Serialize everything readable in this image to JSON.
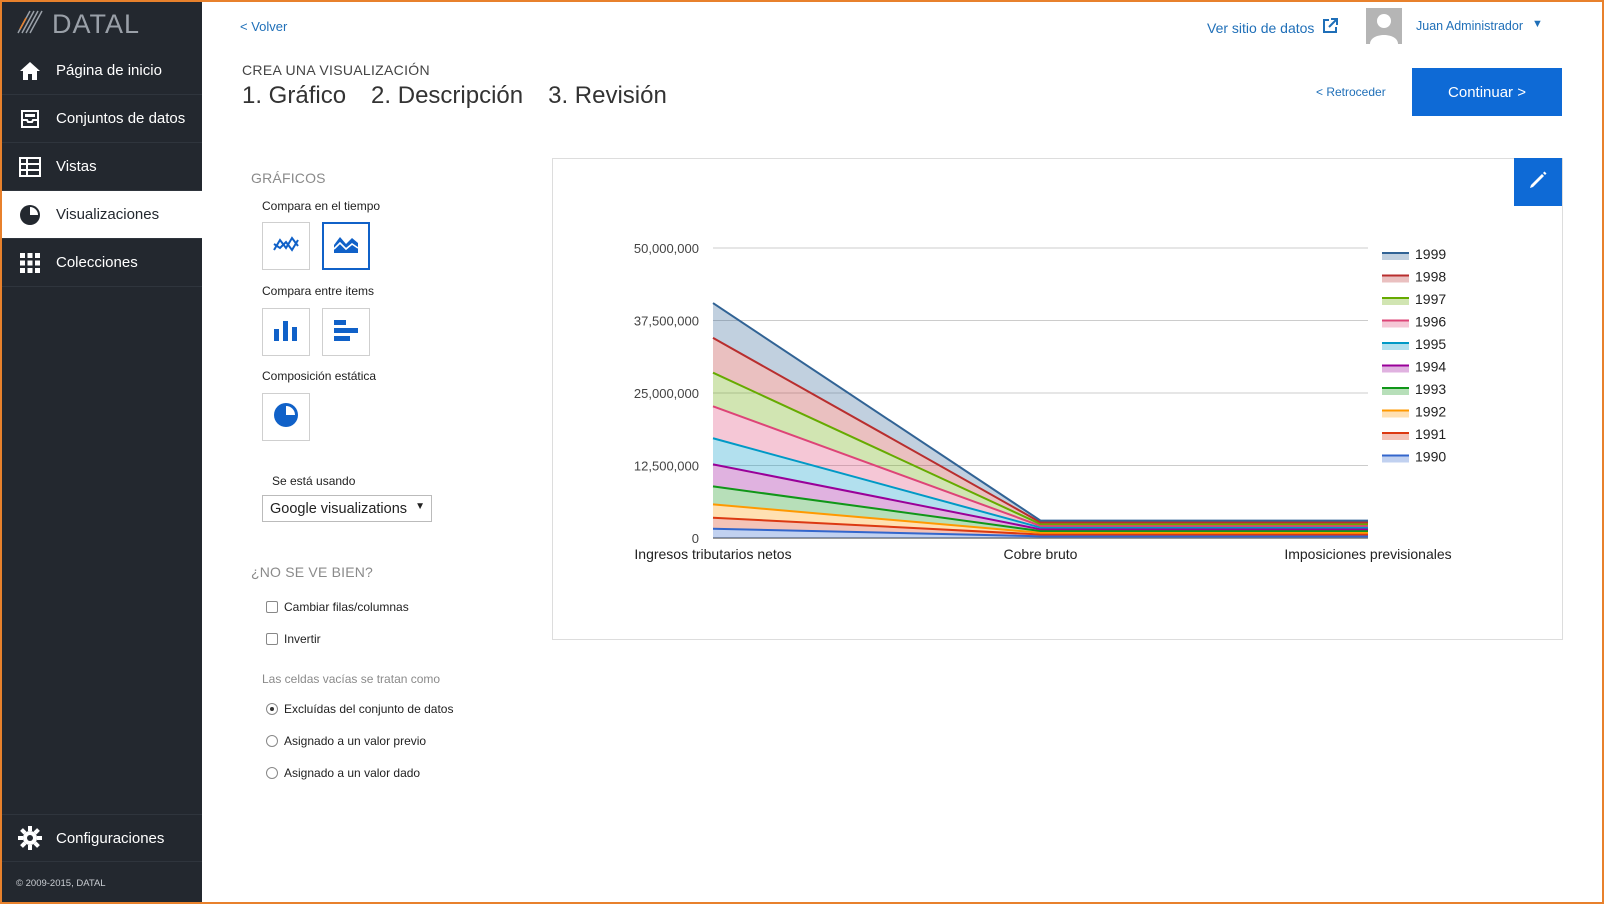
{
  "sidebar": {
    "logo": "DATAL",
    "items": [
      {
        "label": "Página de inicio",
        "icon": "home-icon"
      },
      {
        "label": "Conjuntos de datos",
        "icon": "inbox-icon"
      },
      {
        "label": "Vistas",
        "icon": "table-icon"
      },
      {
        "label": "Visualizaciones",
        "icon": "pie-icon",
        "active": true
      },
      {
        "label": "Colecciones",
        "icon": "grid-icon"
      }
    ],
    "settings": "Configuraciones",
    "copyright": "© 2009-2015, DATAL"
  },
  "header": {
    "back": "< Volver",
    "site_link": "Ver sitio de datos",
    "user": "Juan Administrador",
    "caret": "▼"
  },
  "wizard": {
    "kicker": "CREA UNA VISUALIZACIÓN",
    "steps": [
      "1. Gráfico",
      "2. Descripción",
      "3. Revisión"
    ],
    "back": "< Retroceder",
    "continue": "Continuar >"
  },
  "options": {
    "charts_title": "GRÁFICOS",
    "time_label": "Compara en el tiempo",
    "items_label": "Compara entre items",
    "static_label": "Composición estática",
    "using_label": "Se está usando",
    "library": "Google visualizations",
    "caret": "▼",
    "fix_title": "¿NO SE VE BIEN?",
    "swap": "Cambiar filas/columnas",
    "invert": "Invertir",
    "empty_label": "Las celdas vacías se tratan como",
    "empty_options": [
      "Excluídas del conjunto de datos",
      "Asignado a un valor previo",
      "Asignado a un valor dado"
    ],
    "selected_empty": 0
  },
  "colors": {
    "accent": "#0e6ad6",
    "sidebar": "#23282f",
    "frame": "#e8812c"
  },
  "chart_data": {
    "type": "area",
    "x": [
      "Ingresos tributarios netos",
      "Cobre bruto",
      "Imposiciones previsionales"
    ],
    "ylim": [
      0,
      50000000
    ],
    "yticks": [
      0,
      12500000,
      25000000,
      37500000,
      50000000
    ],
    "ytick_labels": [
      "0",
      "12,500,000",
      "25,000,000",
      "37,500,000",
      "50,000,000"
    ],
    "stacked": true,
    "legend": "right",
    "grid": true,
    "series": [
      {
        "name": "1990",
        "color": "#3366cc",
        "values": [
          1600000,
          300000,
          300000
        ]
      },
      {
        "name": "1991",
        "color": "#dc3912",
        "values": [
          1900000,
          300000,
          300000
        ]
      },
      {
        "name": "1992",
        "color": "#ff9900",
        "values": [
          2300000,
          300000,
          300000
        ]
      },
      {
        "name": "1993",
        "color": "#109618",
        "values": [
          3100000,
          300000,
          300000
        ]
      },
      {
        "name": "1994",
        "color": "#990099",
        "values": [
          3800000,
          300000,
          300000
        ]
      },
      {
        "name": "1995",
        "color": "#0099c6",
        "values": [
          4500000,
          300000,
          300000
        ]
      },
      {
        "name": "1996",
        "color": "#dd4477",
        "values": [
          5500000,
          300000,
          300000
        ]
      },
      {
        "name": "1997",
        "color": "#66aa00",
        "values": [
          5800000,
          300000,
          300000
        ]
      },
      {
        "name": "1998",
        "color": "#b82e2e",
        "values": [
          6000000,
          300000,
          300000
        ]
      },
      {
        "name": "1999",
        "color": "#316395",
        "values": [
          6000000,
          300000,
          300000
        ]
      }
    ]
  }
}
